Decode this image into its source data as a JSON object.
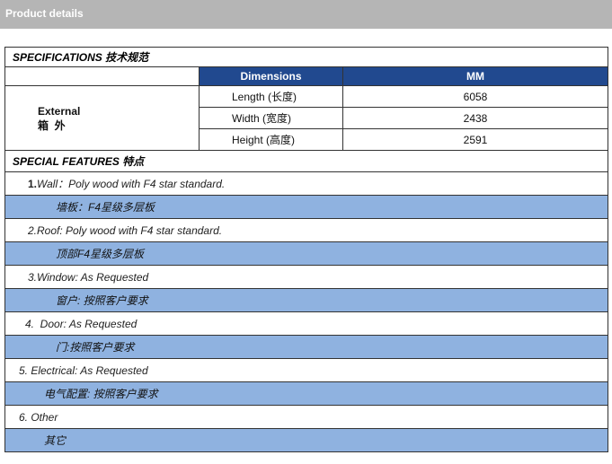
{
  "header": {
    "title": "Product details"
  },
  "specifications": {
    "title": "SPECIFICATIONS 技术规范",
    "col_dimensions": "Dimensions",
    "col_mm": "MM",
    "external_en": "External",
    "external_cn": "箱  外",
    "rows": [
      {
        "label": "Length (长度)",
        "value": "6058"
      },
      {
        "label": "Width (宽度)",
        "value": "2438"
      },
      {
        "label": "Height (高度)",
        "value": "2591"
      }
    ]
  },
  "features": {
    "title": "SPECIAL FEATURES 特点",
    "items": [
      {
        "num": "1.",
        "en": "Wall：Poly wood with F4 star standard.",
        "cn": "墙板：F4星级多层板"
      },
      {
        "en": "2.Roof: Poly wood with F4 star standard.",
        "cn": "顶部F4星级多层板"
      },
      {
        "en": "3.Window: As Requested",
        "cn": "窗户: 按照客户要求"
      },
      {
        "en": "4.  Door: As Requested",
        "cn": "门:按照客户要求"
      },
      {
        "en": "5. Electrical: As Requested",
        "cn": "电气配置: 按照客户要求"
      },
      {
        "en": "6. Other",
        "cn": "其它"
      }
    ]
  }
}
